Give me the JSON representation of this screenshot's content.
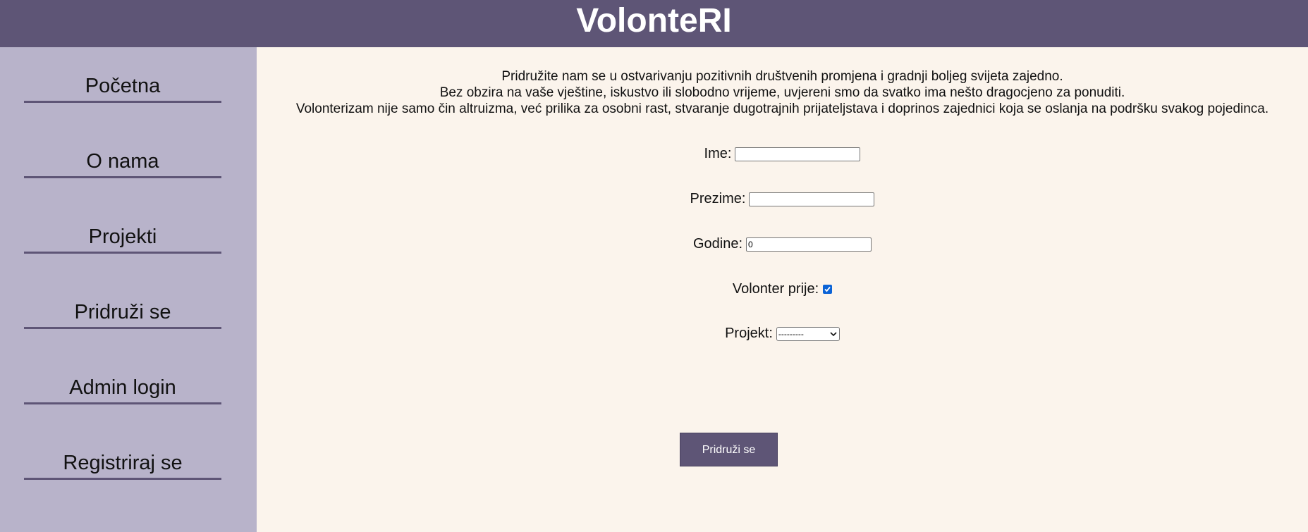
{
  "header": {
    "title": "VolonteRI"
  },
  "sidebar": {
    "items": [
      {
        "label": "Početna"
      },
      {
        "label": "O nama"
      },
      {
        "label": "Projekti"
      },
      {
        "label": "Pridruži se"
      },
      {
        "label": "Admin login"
      },
      {
        "label": "Registriraj se"
      }
    ]
  },
  "main": {
    "intro": [
      "Pridružite nam se u ostvarivanju pozitivnih društvenih promjena i gradnji boljeg svijeta zajedno.",
      "Bez obzira na vaše vještine, iskustvo ili slobodno vrijeme, uvjereni smo da svatko ima nešto dragocjeno za ponuditi.",
      "Volonterizam nije samo čin altruizma, već prilika za osobni rast, stvaranje dugotrajnih prijateljstava i doprinos zajednici koja se oslanja na podršku svakog pojedinca."
    ],
    "form": {
      "first_name_label": "Ime:",
      "first_name_value": "",
      "last_name_label": "Prezime:",
      "last_name_value": "",
      "age_label": "Godine:",
      "age_value": "0",
      "volunteered_label": "Volonter prije:",
      "volunteered_checked": true,
      "project_label": "Projekt:",
      "project_selected": "---------",
      "submit_label": "Pridruži se"
    }
  },
  "colors": {
    "header_bg": "#5e5576",
    "sidebar_bg": "#b8b3ca",
    "main_bg": "#fbf4ec",
    "checkbox_accent": "#0b63d6"
  }
}
